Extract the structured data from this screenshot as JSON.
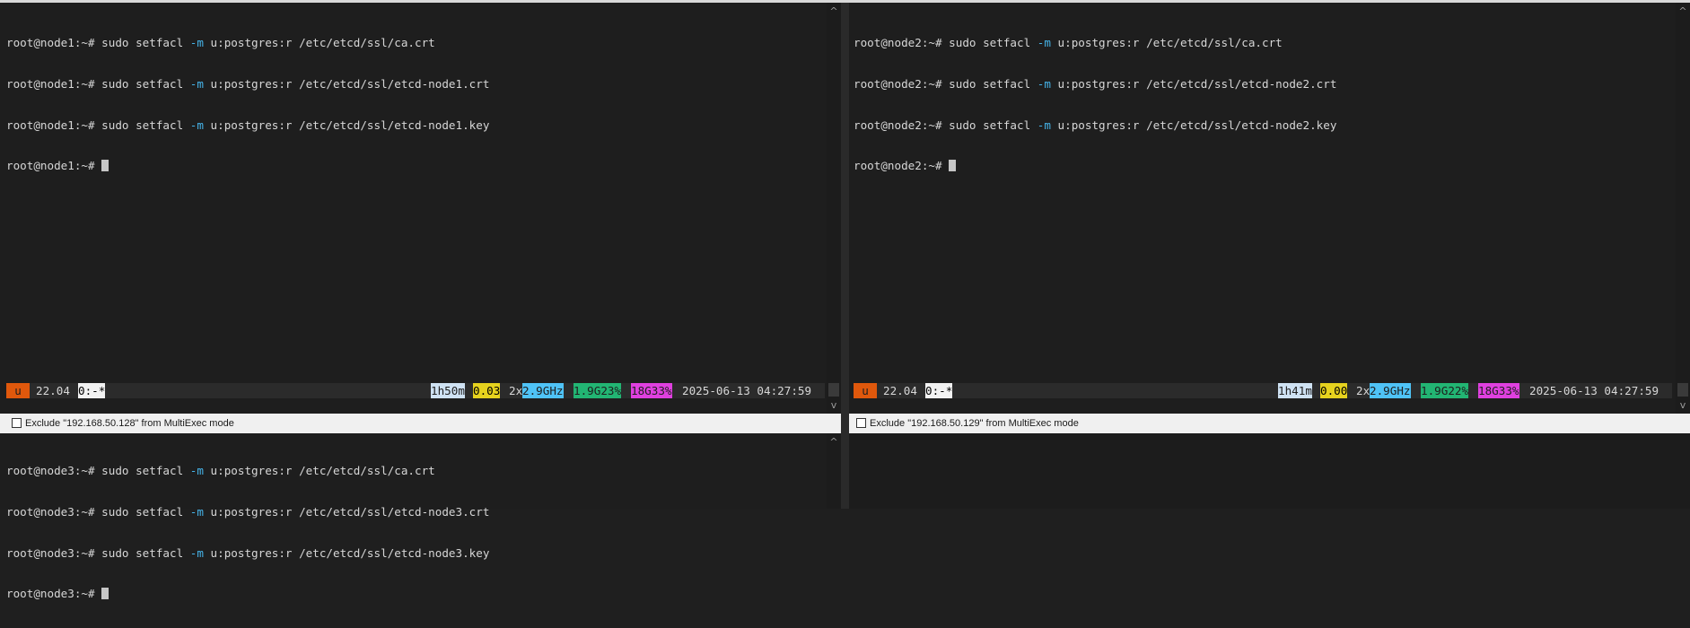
{
  "panes": [
    {
      "host": "node1",
      "lines": [
        {
          "prompt": "root@node1:~#",
          "cmd": "sudo setfacl",
          "flag": "-m",
          "args": "u:postgres:r /etc/etcd/ssl/ca.crt"
        },
        {
          "prompt": "root@node1:~#",
          "cmd": "sudo setfacl",
          "flag": "-m",
          "args": "u:postgres:r /etc/etcd/ssl/etcd-node1.crt"
        },
        {
          "prompt": "root@node1:~#",
          "cmd": "sudo setfacl",
          "flag": "-m",
          "args": "u:postgres:r /etc/etcd/ssl/etcd-node1.key"
        }
      ],
      "final_prompt": "root@node1:~#",
      "status": {
        "session": "u",
        "version": "22.04",
        "window": "0:-*",
        "uptime": "1h50m",
        "load": "0.03",
        "cores": "2x",
        "cpu": "2.9GHz",
        "mem": "1.9G23%",
        "disk": "18G33%",
        "datetime": "2025-06-13 04:27:59"
      },
      "exclude_label": "Exclude \"192.168.50.128\" from MultiExec mode"
    },
    {
      "host": "node2",
      "lines": [
        {
          "prompt": "root@node2:~#",
          "cmd": "sudo setfacl",
          "flag": "-m",
          "args": "u:postgres:r /etc/etcd/ssl/ca.crt"
        },
        {
          "prompt": "root@node2:~#",
          "cmd": "sudo setfacl",
          "flag": "-m",
          "args": "u:postgres:r /etc/etcd/ssl/etcd-node2.crt"
        },
        {
          "prompt": "root@node2:~#",
          "cmd": "sudo setfacl",
          "flag": "-m",
          "args": "u:postgres:r /etc/etcd/ssl/etcd-node2.key"
        }
      ],
      "final_prompt": "root@node2:~#",
      "status": {
        "session": "u",
        "version": "22.04",
        "window": "0:-*",
        "uptime": "1h41m",
        "load": "0.00",
        "cores": "2x",
        "cpu": "2.9GHz",
        "mem": "1.9G22%",
        "disk": "18G33%",
        "datetime": "2025-06-13 04:27:59"
      },
      "exclude_label": "Exclude \"192.168.50.129\" from MultiExec mode"
    },
    {
      "host": "node3",
      "lines": [
        {
          "prompt": "root@node3:~#",
          "cmd": "sudo setfacl",
          "flag": "-m",
          "args": "u:postgres:r /etc/etcd/ssl/ca.crt"
        },
        {
          "prompt": "root@node3:~#",
          "cmd": "sudo setfacl",
          "flag": "-m",
          "args": "u:postgres:r /etc/etcd/ssl/etcd-node3.crt"
        },
        {
          "prompt": "root@node3:~#",
          "cmd": "sudo setfacl",
          "flag": "-m",
          "args": "u:postgres:r /etc/etcd/ssl/etcd-node3.key"
        }
      ],
      "final_prompt": "root@node3:~#"
    }
  ],
  "colors": {
    "session_bg": "#e0580c",
    "window_bg": "#f2f2f2",
    "window_fg": "#000000",
    "uptime_bg": "#cfe2f3",
    "uptime_fg": "#1e1e1e",
    "load_bg": "#e6d21e",
    "load_fg": "#000000",
    "cpu_bg": "#4fc3f7",
    "cpu_fg": "#1e1e1e",
    "mem_bg": "#22b573",
    "mem_fg": "#1e1e1e",
    "disk_bg": "#e040e0",
    "disk_fg": "#1e1e1e",
    "flag": "#45b3e8"
  },
  "icons": {
    "scroll_up": "chevron-up-icon",
    "scroll_down": "chevron-down-icon"
  }
}
